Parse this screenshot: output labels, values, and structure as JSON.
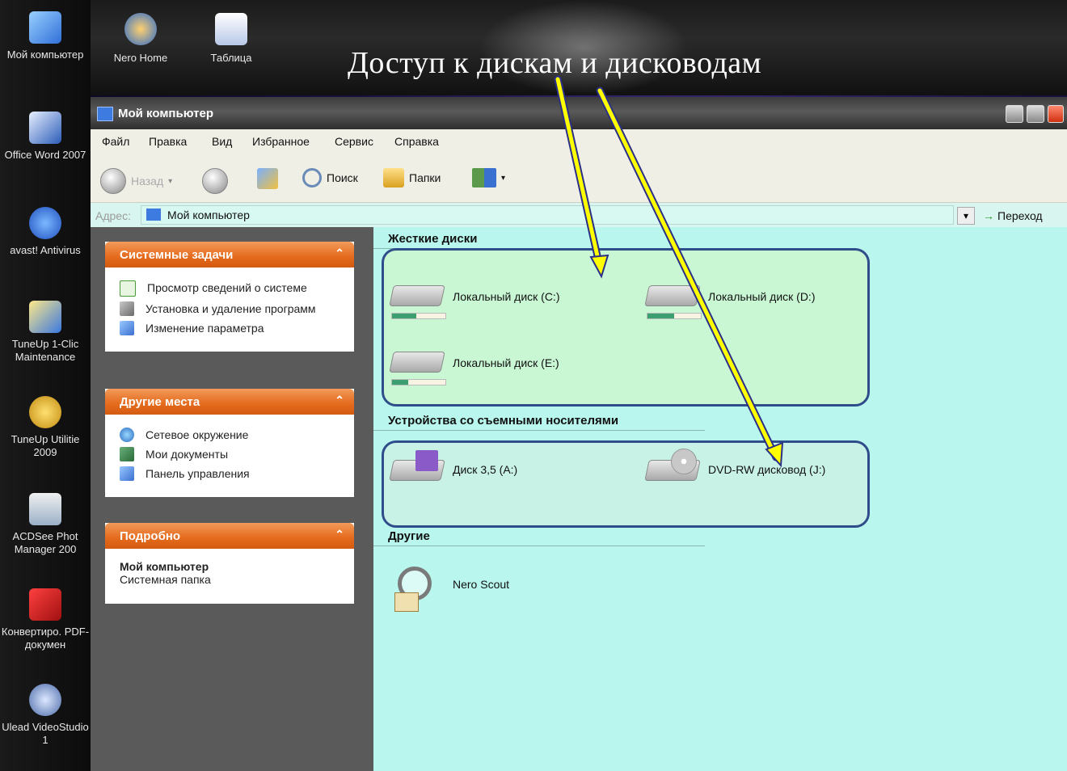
{
  "slide": {
    "title": "Доступ к дискам и дисководам"
  },
  "desktop": {
    "icons": [
      {
        "label": "Мой компьютер"
      },
      {
        "label": "Office Word 2007"
      },
      {
        "label": "avast! Antivirus"
      },
      {
        "label": "TuneUp 1-Clic Maintenance"
      },
      {
        "label": "TuneUp Utilitie 2009"
      },
      {
        "label": "ACDSee Phot Manager 200"
      },
      {
        "label": "Конвертиро. PDF-докумен"
      },
      {
        "label": "Ulead VideoStudio 1"
      }
    ],
    "top_icons": [
      {
        "label": "Nero Home"
      },
      {
        "label": "Таблица"
      }
    ]
  },
  "window": {
    "title": "Мой компьютер",
    "menu": [
      "Файл",
      "Правка",
      "Вид",
      "Избранное",
      "Сервис",
      "Справка"
    ],
    "toolbar": {
      "back": "Назад",
      "search": "Поиск",
      "folders": "Папки"
    },
    "address": {
      "label": "Адрес:",
      "value": "Мой компьютер",
      "go": "Переход"
    }
  },
  "left_panel": {
    "system_tasks": {
      "title": "Системные задачи",
      "items": [
        "Просмотр сведений о системе",
        "Установка и удаление программ",
        "Изменение параметра"
      ]
    },
    "other_places": {
      "title": "Другие места",
      "items": [
        "Сетевое окружение",
        "Мои документы",
        "Панель управления"
      ]
    },
    "details": {
      "title": "Подробно",
      "name": "Мой компьютер",
      "desc": "Системная папка"
    }
  },
  "content": {
    "hard_disks": {
      "title": "Жесткие диски",
      "items": [
        {
          "label": "Локальный диск (C:)",
          "used": 0.45
        },
        {
          "label": "Локальный диск (D:)",
          "used": 0.5
        },
        {
          "label": "Локальный диск (E:)",
          "used": 0.3
        }
      ]
    },
    "removable": {
      "title": "Устройства со съемными носителями",
      "items": [
        {
          "label": "Диск 3,5 (A:)"
        },
        {
          "label": "DVD-RW дисковод (J:)"
        }
      ]
    },
    "other": {
      "title": "Другие",
      "items": [
        {
          "label": "Nero Scout"
        }
      ]
    }
  },
  "colors": {
    "content_bg": "#b9f7ee",
    "group_box_border": "#2f4d8a",
    "panel_header": "#e46a1c",
    "arrow": "#ffff00"
  }
}
